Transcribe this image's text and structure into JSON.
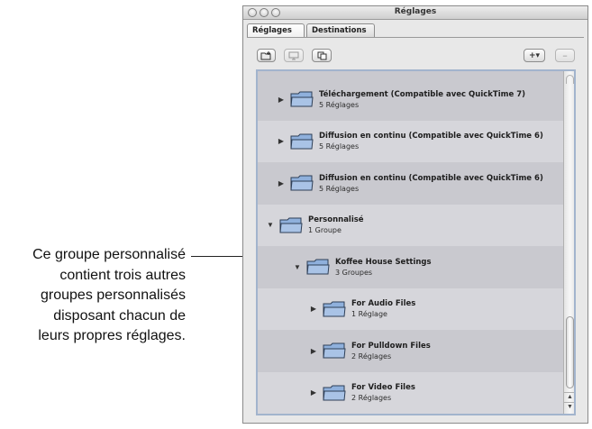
{
  "callout": {
    "lines": [
      "Ce groupe personnalisé",
      "contient trois autres",
      "groupes personnalisés",
      "disposant chacun de",
      "leurs propres réglages."
    ]
  },
  "window": {
    "title": "Réglages",
    "tabs": [
      {
        "label": "Réglages",
        "active": true
      },
      {
        "label": "Destinations",
        "active": false
      }
    ],
    "toolbar": {
      "new_group_icon": "folder-add-icon",
      "show_details_icon": "monitor-icon",
      "duplicate_icon": "duplicate-icon",
      "add_label": "+▾",
      "remove_label": "–"
    }
  },
  "list": {
    "rows": [
      {
        "expanded": false,
        "indent": 0,
        "title": "Téléchargement (Compatible avec QuickTime 7)",
        "subtitle": "5 Réglages"
      },
      {
        "expanded": false,
        "indent": 0,
        "title": "Diffusion en continu (Compatible avec QuickTime 6)",
        "subtitle": "5 Réglages"
      },
      {
        "expanded": false,
        "indent": 0,
        "title": "Diffusion en continu (Compatible avec QuickTime 6)",
        "subtitle": "5 Réglages"
      },
      {
        "expanded": true,
        "indent": 0,
        "title": "Personnalisé",
        "subtitle": "1 Groupe"
      },
      {
        "expanded": true,
        "indent": 1,
        "title": "Koffee House Settings",
        "subtitle": "3 Groupes"
      },
      {
        "expanded": false,
        "indent": 2,
        "title": "For Audio Files",
        "subtitle": "1 Réglage"
      },
      {
        "expanded": false,
        "indent": 2,
        "title": "For Pulldown Files",
        "subtitle": "2 Réglages"
      },
      {
        "expanded": false,
        "indent": 2,
        "title": "For Video Files",
        "subtitle": "2 Réglages"
      }
    ]
  },
  "colors": {
    "folder_fill": "#8fb0dc",
    "folder_stroke": "#2e3f57",
    "list_border": "#a2b4cd"
  }
}
